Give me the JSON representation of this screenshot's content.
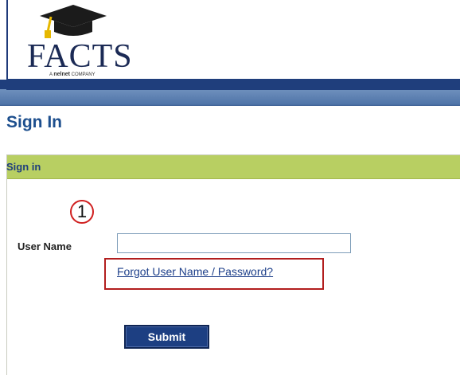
{
  "header": {
    "logo_text": "FACTS",
    "logo_tagline_prefix": "A",
    "logo_tagline_brand": "nelnet",
    "logo_tagline_suffix": "COMPANY"
  },
  "page": {
    "title": "Sign In"
  },
  "panel": {
    "title": "Sign in",
    "callout_number": "1",
    "username_label": "User Name",
    "username_value": "",
    "forgot_link": "Forgot User Name / Password?",
    "submit_label": "Submit"
  },
  "colors": {
    "title_blue": "#1d4f8e",
    "panel_header_green": "#b8cf62",
    "button_navy": "#1d3f82",
    "highlight_red": "#b21e1e"
  }
}
